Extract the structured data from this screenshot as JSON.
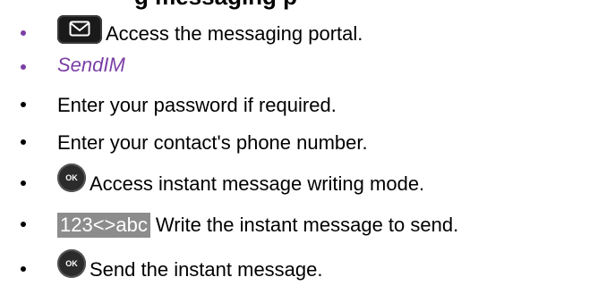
{
  "heading": {
    "partial_text": "g messaging p"
  },
  "steps": [
    {
      "text": "Access the messaging portal.",
      "key": "envelope-key",
      "bullet_color": "#7b3fa6"
    },
    {
      "text": "SendIM",
      "key": null,
      "bullet_color": "#7b3fa6",
      "text_color": "#7b3fa6",
      "italic": true
    },
    {
      "text": "Enter your password if required.",
      "key": null,
      "bullet_color": "#000000"
    },
    {
      "text": "Enter your contact's phone number.",
      "key": null,
      "bullet_color": "#000000"
    },
    {
      "text": "Access instant message writing mode.",
      "key": "ok-key",
      "key_label": "OK",
      "bullet_color": "#000000"
    },
    {
      "text": "Write the instant message to send.",
      "key": "abc-key",
      "key_label": "123<>abc",
      "bullet_color": "#000000"
    },
    {
      "text": "Send the instant message.",
      "key": "ok-key",
      "key_label": "OK",
      "bullet_color": "#000000"
    }
  ],
  "colors": {
    "accent_purple": "#7b3fa6",
    "key_dark": "#1a1a1a",
    "abc_key_bg": "#8c8c8c"
  }
}
